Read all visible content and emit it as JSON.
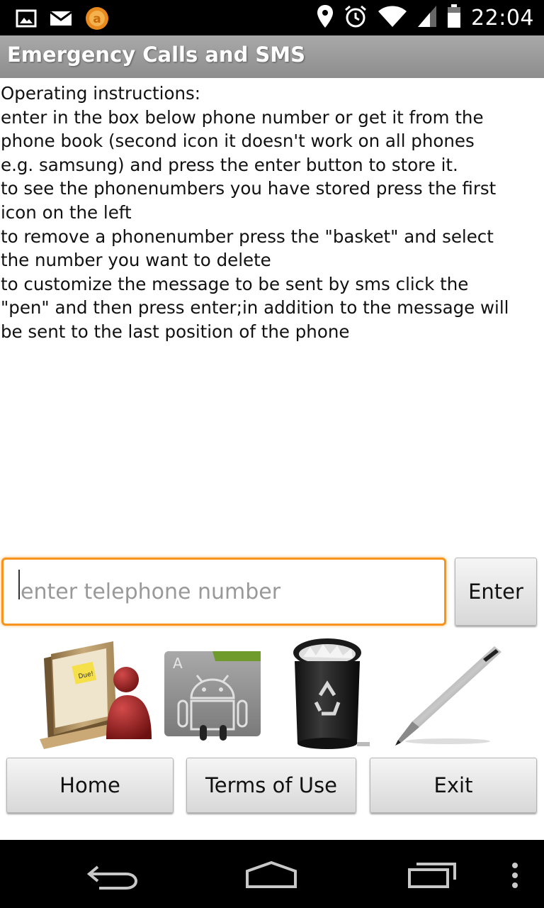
{
  "status_bar": {
    "time": "22:04",
    "left_icons": [
      "image-notification-icon",
      "mail-notification-icon",
      "app-notification-icon"
    ],
    "right_icons": [
      "location-icon",
      "alarm-icon",
      "wifi-icon",
      "signal-icon",
      "battery-icon"
    ]
  },
  "app": {
    "title": "Emergency Calls and SMS"
  },
  "instructions": {
    "text": "Operating instructions:\nenter in the box below phone number or get it from the\nphone book (second icon  it doesn't work on all phones\ne.g. samsung) and press the enter button to store it.\nto see the phonenumbers you have stored press the first\nicon on the left\nto remove a phonenumber press the \"basket\" and select\nthe number you want to delete\nto customize the message to be sent by sms click the\n\"pen\" and then press enter;in addition to the message will\nbe sent to the last position of the phone"
  },
  "phone_input": {
    "value": "",
    "placeholder": "enter telephone number"
  },
  "buttons": {
    "enter": "Enter",
    "home": "Home",
    "terms": "Terms of Use",
    "exit": "Exit"
  },
  "icons": [
    "contacts-folder-icon",
    "android-phonebook-icon",
    "recycle-bin-icon",
    "pen-icon"
  ],
  "colors": {
    "accent": "#f7941d",
    "title_bar": "#9a9a9a",
    "status_bar": "#000000"
  },
  "nav_bar": [
    "back-icon",
    "home-icon",
    "recents-icon",
    "menu-icon"
  ]
}
